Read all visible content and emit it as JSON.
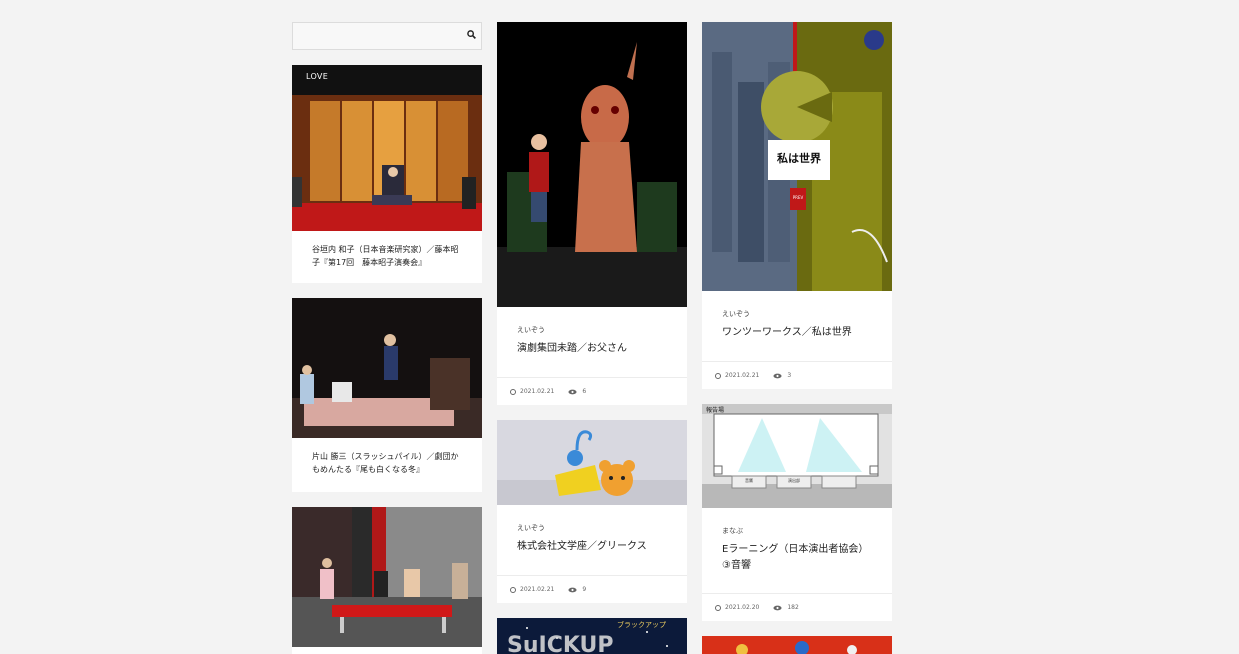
{
  "search": {
    "placeholder": "",
    "icon": "search-icon"
  },
  "column1": [
    {
      "tag": "LOVE",
      "title": "谷垣内 和子（日本音楽研究家）／藤本昭子『第17回　藤本昭子演奏会』"
    },
    {
      "title": "片山 勝三（スラッシュパイル）／劇団かもめんたる『尾も白くなる冬』"
    },
    {
      "title": ""
    }
  ],
  "column2": [
    {
      "category": "えいぞう",
      "title": "演劇集団未踏／お父さん",
      "date": "2021.02.21",
      "views": "6"
    },
    {
      "category": "えいぞう",
      "title": "株式会社文学座／グリークス",
      "date": "2021.02.21",
      "views": "9"
    },
    {
      "overlay_text": "ブラックアップ"
    }
  ],
  "column3": [
    {
      "category": "えいぞう",
      "title": "ワンツーワークス／私は世界",
      "date": "2021.02.21",
      "views": "3",
      "poster_text": "私は世界",
      "poster_badge": "PREV"
    },
    {
      "category": "まなぶ",
      "title": "Eラーニング（日本演出者協会）③音響",
      "date": "2021.02.20",
      "views": "182",
      "screen_label": "報告場",
      "buttons": [
        "音響",
        "演出部",
        ""
      ]
    },
    {}
  ],
  "colors": {
    "background": "#f3f3f3",
    "card": "#ffffff",
    "text": "#222222"
  }
}
